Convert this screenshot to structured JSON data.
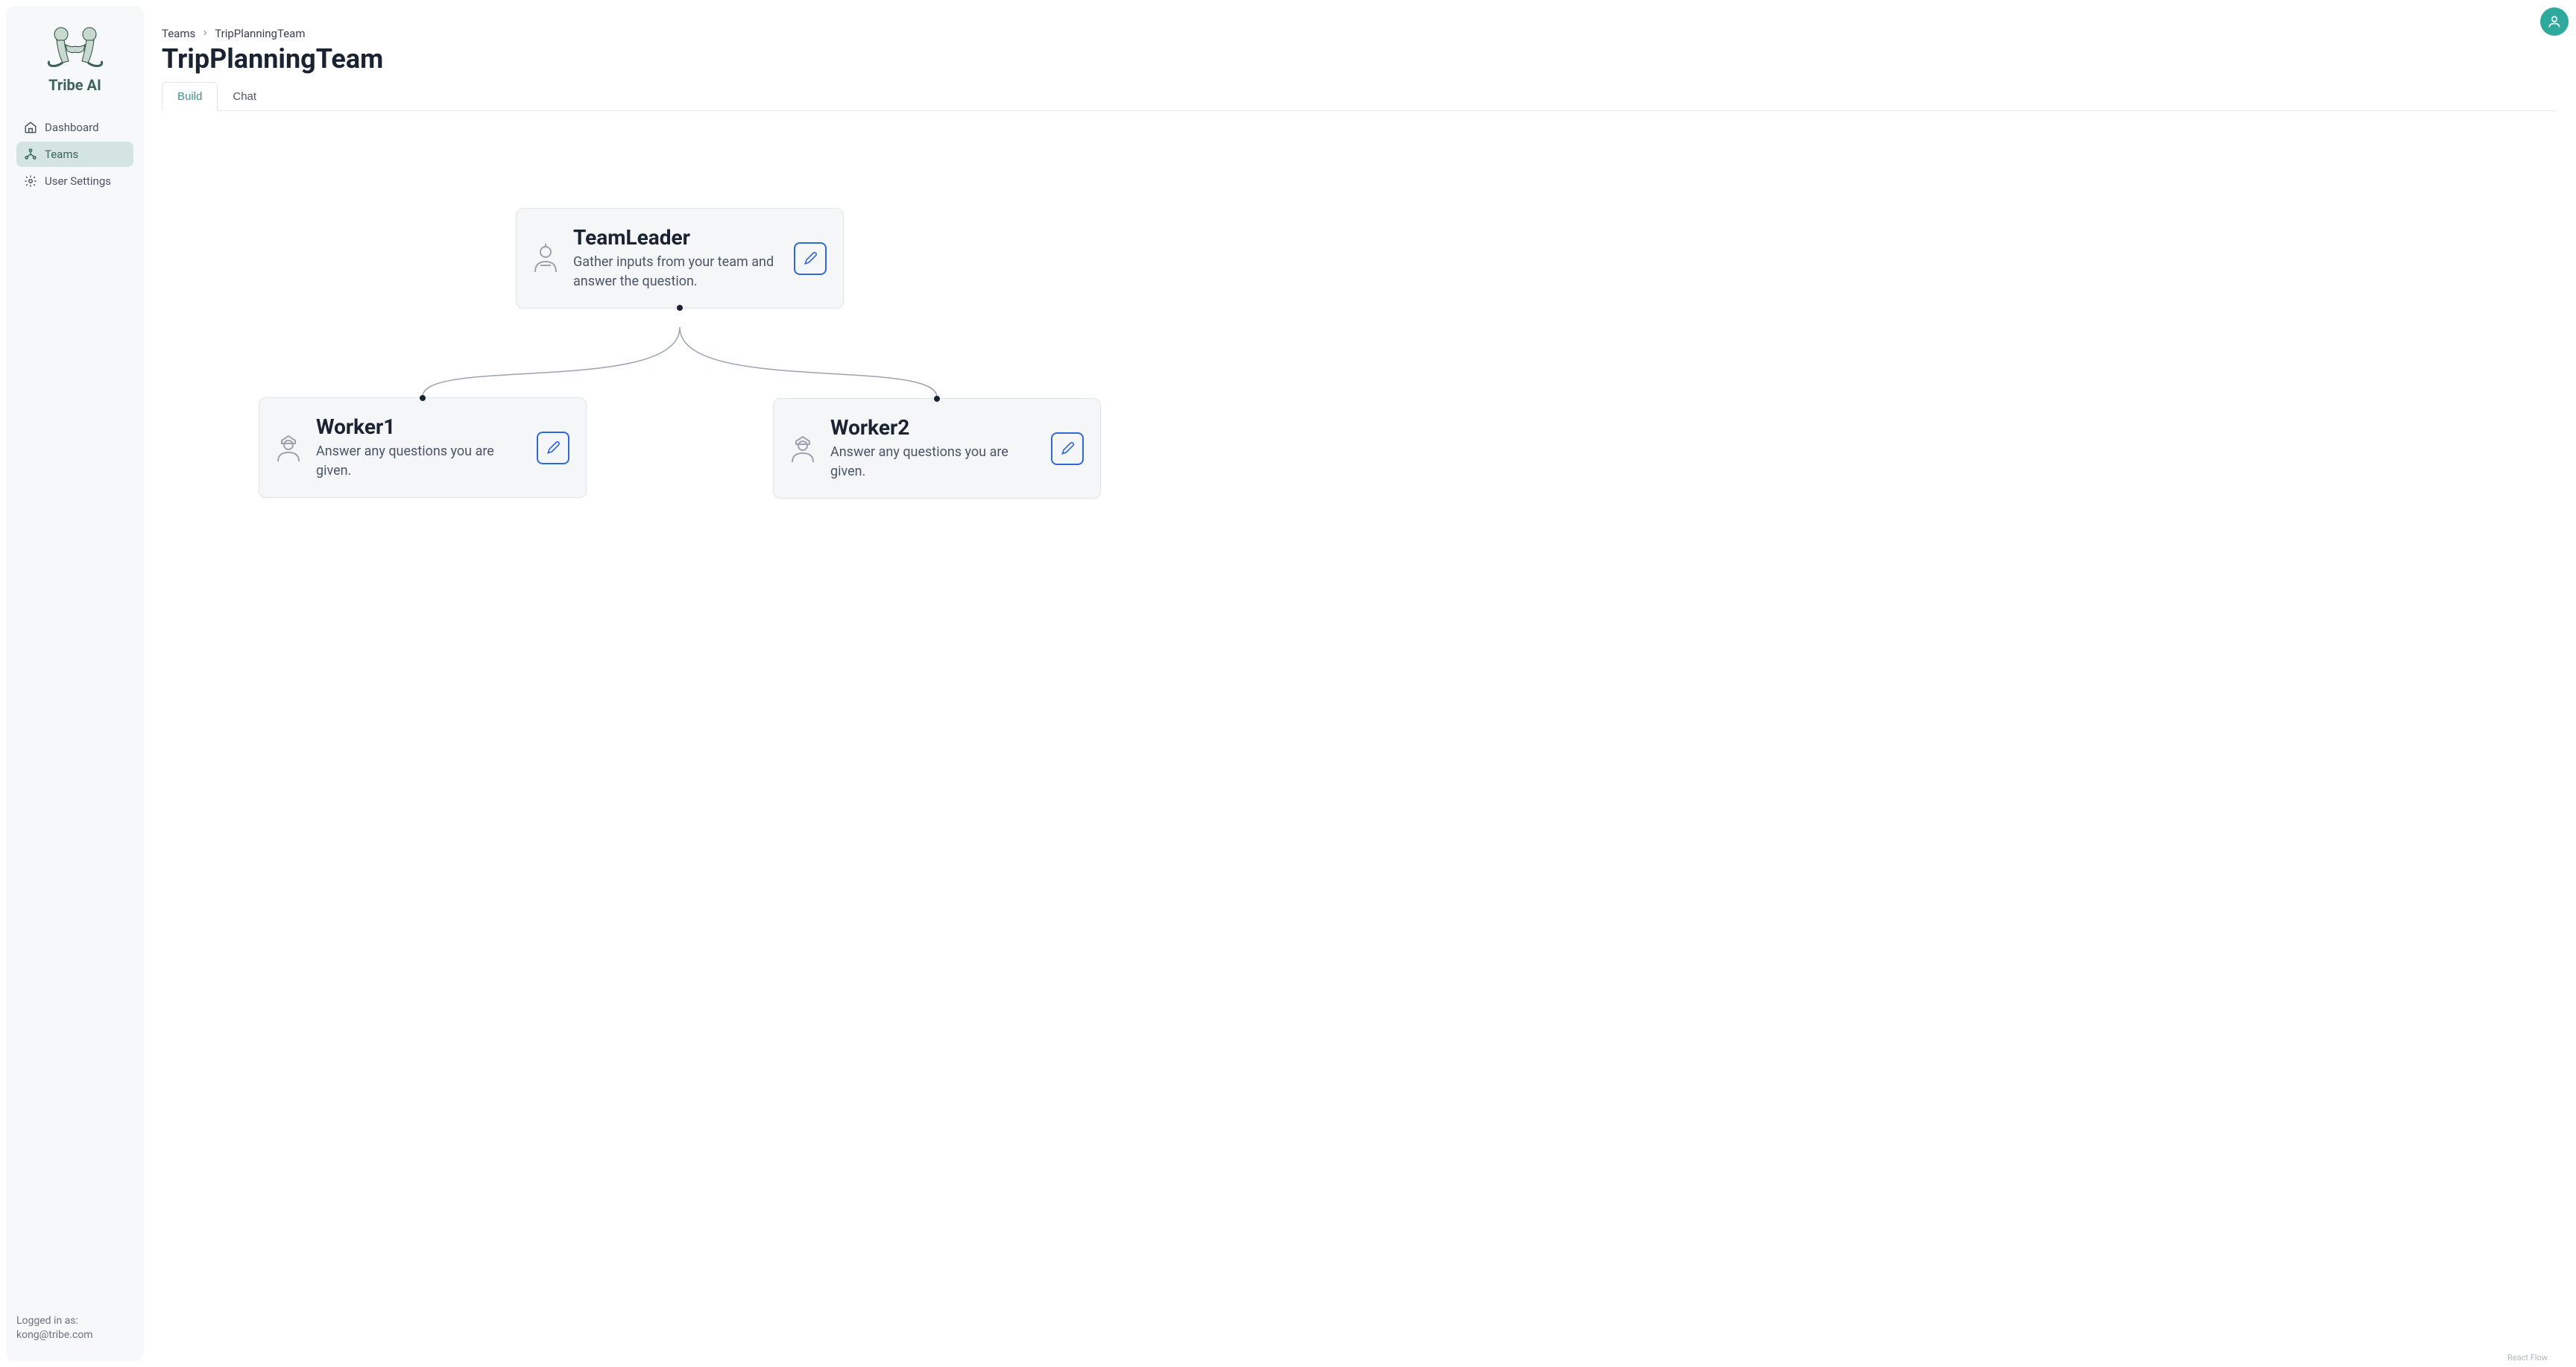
{
  "brand": "Tribe AI",
  "sidebar": {
    "items": [
      {
        "label": "Dashboard",
        "active": false
      },
      {
        "label": "Teams",
        "active": true
      },
      {
        "label": "User Settings",
        "active": false
      }
    ],
    "login_prefix": "Logged in as:",
    "login_user": "kong@tribe.com"
  },
  "breadcrumb": {
    "root": "Teams",
    "current": "TripPlanningTeam"
  },
  "page_title": "TripPlanningTeam",
  "tabs": {
    "build": "Build",
    "chat": "Chat"
  },
  "nodes": {
    "leader": {
      "title": "TeamLeader",
      "desc": "Gather inputs from your team and answer the question."
    },
    "worker1": {
      "title": "Worker1",
      "desc": "Answer any questions you are given."
    },
    "worker2": {
      "title": "Worker2",
      "desc": "Answer any questions you are given."
    }
  },
  "attribution": "React Flow"
}
